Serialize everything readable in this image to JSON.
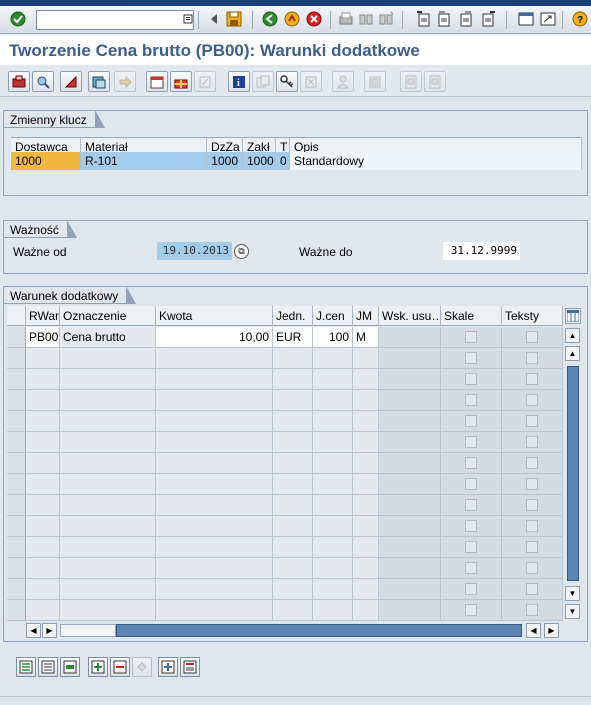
{
  "window": {
    "title": "Tworzenie Cena brutto (PB00): Warunki dodatkowe"
  },
  "toolbar": {
    "command_field": {
      "value": "",
      "placeholder": ""
    },
    "buttons": [
      "enter-icon",
      "save-icon",
      "back-icon",
      "exit-icon",
      "cancel-icon",
      "print-icon",
      "find-icon",
      "find-next-icon",
      "first-page-icon",
      "previous-page-icon",
      "next-page-icon",
      "last-page-icon",
      "help-icon"
    ]
  },
  "app_toolbar": {
    "buttons": [
      "change-icon",
      "display-icon",
      "scales-icon",
      "execute-icon",
      "additional-data-icon",
      "gift-icon",
      "edit-icon",
      "info-icon",
      "copy-icon",
      "key-icon",
      "delete-icon",
      "person-icon",
      "copy-condition-icon",
      "detail-icon",
      "detail2-icon"
    ]
  },
  "key_section": {
    "title": "Zmienny klucz",
    "columns": [
      "Dostawca",
      "Materiał",
      "DzZa",
      "Zakł",
      "T",
      "Opis"
    ],
    "row": [
      "1000",
      "R-101",
      "1000",
      "1000",
      "0",
      "Standardowy"
    ]
  },
  "validity": {
    "title": "Ważność",
    "valid_from_label": "Ważne od",
    "valid_from": "19.10.2013",
    "valid_to_label": "Ważne do",
    "valid_to": "31.12.9999"
  },
  "conditions": {
    "title": "Warunek dodatkowy",
    "columns": [
      "RWar",
      "Oznaczenie",
      "Kwota",
      "Jedn.",
      "J.cen",
      "JM",
      "Wsk. usu…",
      "Skale",
      "Teksty"
    ],
    "rows": [
      [
        "PB00",
        "Cena brutto",
        "10,00",
        "EUR",
        "100",
        "M",
        "",
        "",
        ""
      ]
    ],
    "empty_rows": 13
  },
  "bottom_toolbar": {
    "buttons": [
      "select-all-icon",
      "deselect-icon",
      "select-block-icon",
      "insert-row-icon",
      "delete-row-icon",
      "undo-icon",
      "details-icon",
      "choose-icon"
    ]
  }
}
